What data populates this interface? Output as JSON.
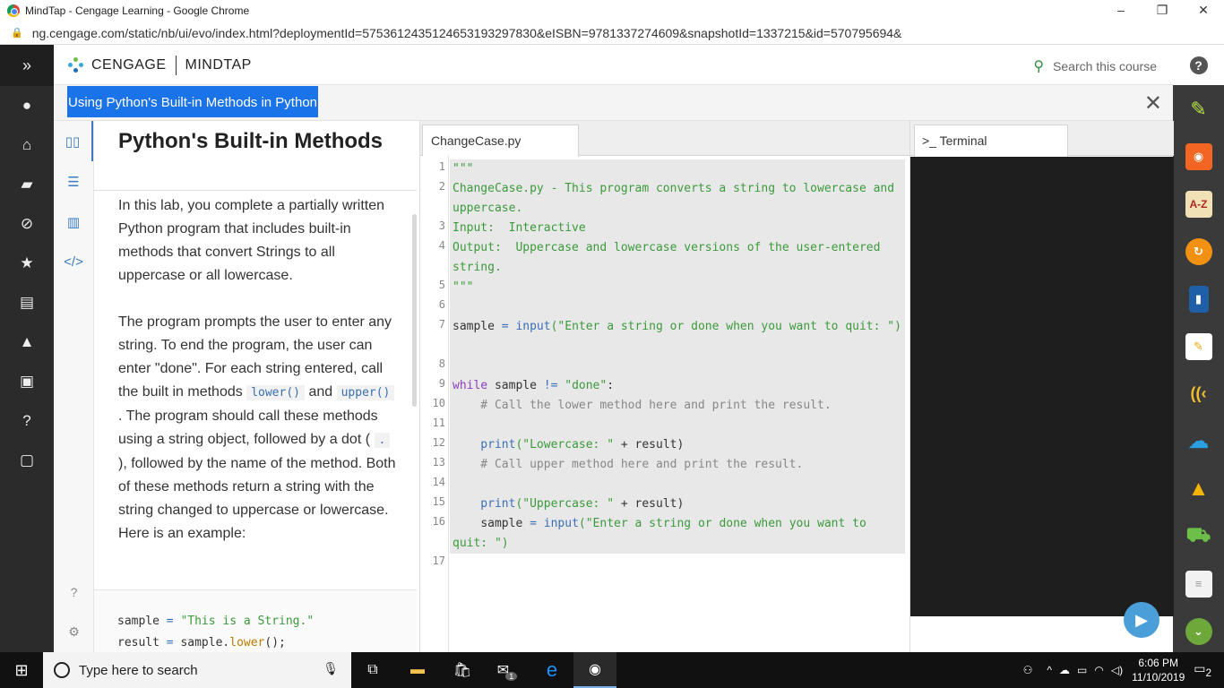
{
  "window": {
    "title": "MindTap - Cengage Learning - Google Chrome",
    "minimize": "–",
    "restore": "❐",
    "close": "✕"
  },
  "browser": {
    "url": "ng.cengage.com/static/nb/ui/evo/index.html?deploymentId=5753612435124653193297830&eISBN=9781337274609&snapshotId=1337215&id=570795694&"
  },
  "header": {
    "brand": "CENGAGE",
    "product": "MINDTAP",
    "search_placeholder": "Search this course"
  },
  "activity": {
    "title": "Using Python's Built-in Methods in Python",
    "close": "✕"
  },
  "instructions": {
    "heading": "Python's Built-in Methods",
    "para1": "In this lab, you complete a partially written Python program that includes built-in methods that convert Strings to all uppercase or all lowercase.",
    "para2_a": "The program prompts the user to enter any string. To end the program, the user can enter \"done\". For each string entered, call the built in methods ",
    "code_lower": "lower()",
    "para2_b": " and ",
    "code_upper": "upper()",
    "para2_c": " . The program should call these methods using a string object, followed by a dot ( ",
    "code_dot": ".",
    "para2_d": " ), followed by the name of the method. Both of these methods return a string with the string changed to uppercase or lowercase. Here is an example:",
    "example_line1": "sample = \"This is a String.\"",
    "example_line2": "result = sample.lower();"
  },
  "editor": {
    "tab": "ChangeCase.py",
    "line_numbers": [
      "1",
      "2",
      "3",
      "4",
      "5",
      "6",
      "7",
      "8",
      "9",
      "10",
      "11",
      "12",
      "13",
      "14",
      "15",
      "16",
      "17"
    ],
    "lines": {
      "l1": "\"\"\"",
      "l2": "ChangeCase.py - This program converts a string to lowercase and uppercase.",
      "l3": "Input:  Interactive",
      "l4": "Output:  Uppercase and lowercase versions of the user-entered string.",
      "l5": "\"\"\"",
      "l7_var": "sample",
      "l7_eq": " = ",
      "l7_fn": "input",
      "l7_str": "(\"Enter a string or done when you want to quit: \")",
      "l9_kw": "while",
      "l9_rest": " sample ",
      "l9_op": "!=",
      "l9_str": " \"done\"",
      "l9_end": ":",
      "l10": "    # Call the lower method here and print the result.",
      "l12_fn": "    print",
      "l12_str": "(\"Lowercase: \"",
      "l12_rest": " + result)",
      "l13": "    # Call upper method here and print the result.",
      "l15_fn": "    print",
      "l15_str": "(\"Uppercase: \"",
      "l15_rest": " + result)",
      "l16_var": "    sample",
      "l16_eq": " = ",
      "l16_fn": "input",
      "l16_str": "(\"Enter a string or done when you want to quit: \")"
    }
  },
  "terminal": {
    "tab": "Terminal"
  },
  "taskbar": {
    "search_placeholder": "Type here to search",
    "time": "6:06 PM",
    "date": "11/10/2019",
    "notifications": "2",
    "mail_badge": "1"
  },
  "icons": {
    "rail": [
      "expand-icon",
      "user-icon",
      "home-icon",
      "notebook-icon",
      "compass-icon",
      "star-icon",
      "ebook-icon",
      "graduation-cap-icon",
      "briefcase-icon",
      "help-icon",
      "feedback-icon"
    ],
    "apps": [
      "highlighter-icon",
      "rss-icon",
      "a-z-dictionary-icon",
      "sync-icon",
      "book-icon",
      "notepad-icon",
      "read-speaker-icon",
      "onedrive-icon",
      "google-drive-icon",
      "cart-icon",
      "notes-icon",
      "chevron-down-icon"
    ]
  }
}
